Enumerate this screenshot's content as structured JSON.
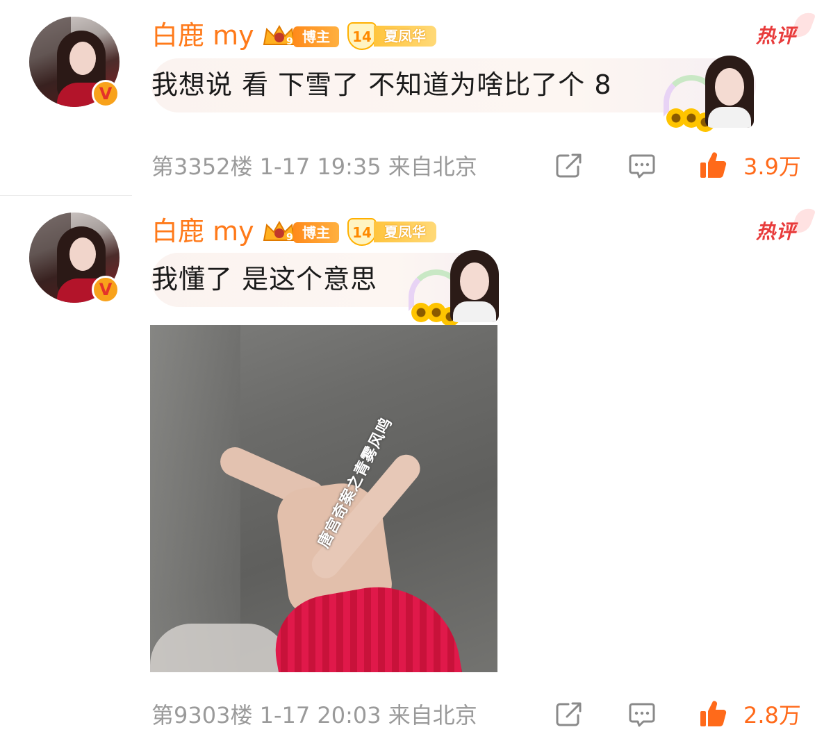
{
  "comments": [
    {
      "user": {
        "name": "白鹿 my",
        "role_badge": "博主",
        "fan_level": "14",
        "fan_group": "夏凤华",
        "verified_mark": "V"
      },
      "hot_tag": "热评",
      "text": "我想说 看 下雪了 不知道为啥比了个 8",
      "meta": "第3352楼 1-17 19:35 来自北京",
      "likes": "3.9万",
      "icons": {
        "share": "share-icon",
        "comment": "comment-icon",
        "like": "thumbs-up-icon"
      }
    },
    {
      "user": {
        "name": "白鹿 my",
        "role_badge": "博主",
        "fan_level": "14",
        "fan_group": "夏凤华",
        "verified_mark": "V"
      },
      "hot_tag": "热评",
      "text": "我懂了 是这个意思",
      "image_watermark": "唐宫奇案之青雾风鸣",
      "meta": "第9303楼 1-17 20:03 来自北京",
      "likes": "2.8万",
      "icons": {
        "share": "share-icon",
        "comment": "comment-icon",
        "like": "thumbs-up-icon"
      }
    }
  ],
  "colors": {
    "name": "#ff7a1a",
    "hot": "#e83b3b",
    "meta": "#9a9a9a",
    "likes": "#ff6a1a"
  }
}
